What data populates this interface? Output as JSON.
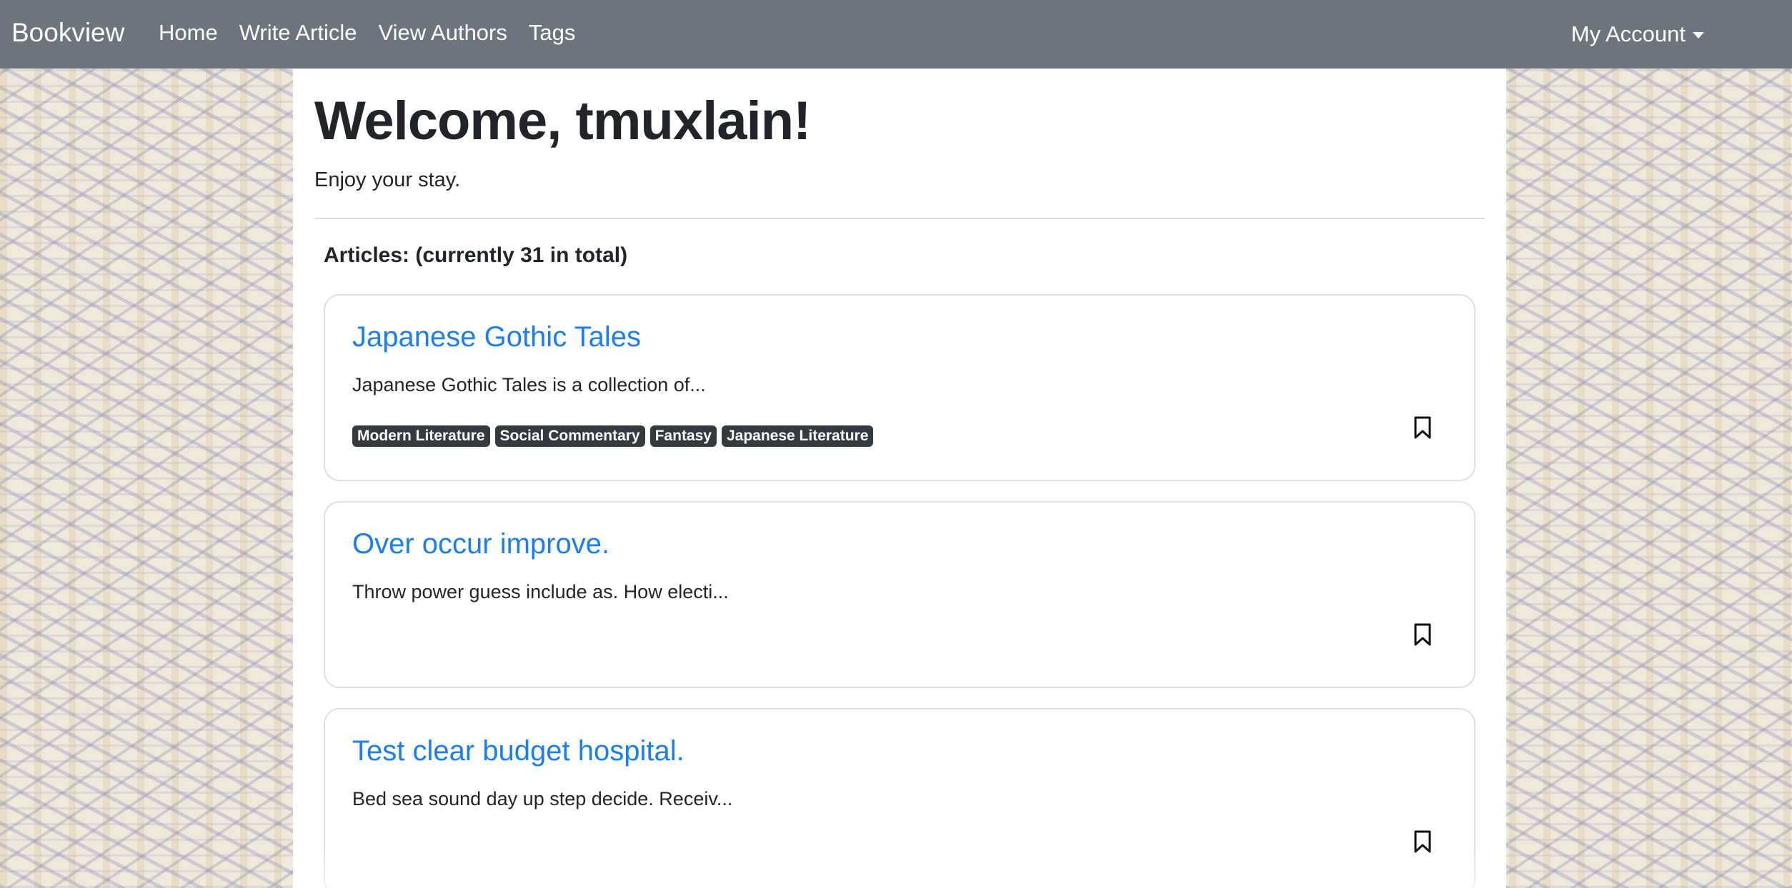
{
  "navbar": {
    "brand": "Bookview",
    "links": [
      "Home",
      "Write Article",
      "View Authors",
      "Tags"
    ],
    "account_label": "My Account"
  },
  "main": {
    "welcome": "Welcome, tmuxlain!",
    "subtitle": "Enjoy your stay.",
    "articles_heading": "Articles: (currently 31 in total)",
    "articles": [
      {
        "title": "Japanese Gothic Tales",
        "excerpt": "Japanese Gothic Tales is a collection of...",
        "tags": [
          "Modern Literature",
          "Social Commentary",
          "Fantasy",
          "Japanese Literature"
        ],
        "bookmark_icon": "bookmark-icon"
      },
      {
        "title": "Over occur improve.",
        "excerpt": "Throw power guess include as. How electi...",
        "tags": [],
        "bookmark_icon": "bookmark-icon"
      },
      {
        "title": "Test clear budget hospital.",
        "excerpt": "Bed sea sound day up step decide. Receiv...",
        "tags": [],
        "bookmark_icon": "bookmark-icon"
      }
    ]
  },
  "colors": {
    "navbar": "#6c757d",
    "link": "#1e7ee8",
    "tag_badge": "#343a40",
    "text": "#212529"
  }
}
